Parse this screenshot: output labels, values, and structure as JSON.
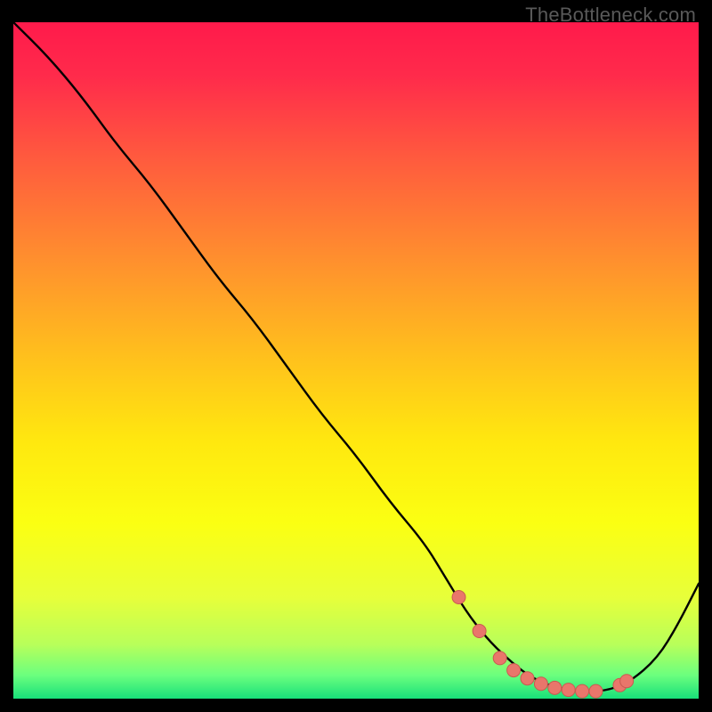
{
  "watermark": "TheBottleneck.com",
  "colors": {
    "gradient_stops": [
      {
        "offset": 0.0,
        "color": "#ff1a4b"
      },
      {
        "offset": 0.08,
        "color": "#ff2b4b"
      },
      {
        "offset": 0.2,
        "color": "#ff5a3e"
      },
      {
        "offset": 0.35,
        "color": "#ff8f2e"
      },
      {
        "offset": 0.5,
        "color": "#ffc21c"
      },
      {
        "offset": 0.62,
        "color": "#ffe80f"
      },
      {
        "offset": 0.74,
        "color": "#fbff12"
      },
      {
        "offset": 0.85,
        "color": "#e7ff3a"
      },
      {
        "offset": 0.92,
        "color": "#b8ff5a"
      },
      {
        "offset": 0.965,
        "color": "#6cff7e"
      },
      {
        "offset": 1.0,
        "color": "#18e07a"
      }
    ],
    "curve": "#000000",
    "marker_fill": "#e9766b",
    "marker_stroke": "#c95a50"
  },
  "chart_data": {
    "type": "line",
    "title": "",
    "xlabel": "",
    "ylabel": "",
    "xlim": [
      0,
      100
    ],
    "ylim": [
      0,
      100
    ],
    "series": [
      {
        "name": "bottleneck-curve",
        "x": [
          0,
          5,
          10,
          15,
          20,
          25,
          30,
          35,
          40,
          45,
          50,
          55,
          60,
          63,
          66,
          69,
          72,
          75,
          78,
          81,
          84,
          87,
          90,
          94,
          97,
          100
        ],
        "y": [
          100,
          95,
          89,
          82,
          76,
          69,
          62,
          56,
          49,
          42,
          36,
          29,
          23,
          18,
          13,
          9,
          6,
          3.5,
          2,
          1.3,
          1,
          1.3,
          2.5,
          6,
          11,
          17
        ]
      }
    ],
    "markers": {
      "name": "highlight-points",
      "x": [
        65,
        68,
        71,
        73,
        75,
        77,
        79,
        81,
        83,
        85,
        88.5,
        89.5
      ],
      "y": [
        15,
        10,
        6,
        4.2,
        3,
        2.2,
        1.6,
        1.3,
        1.1,
        1.1,
        2.0,
        2.6
      ]
    }
  }
}
